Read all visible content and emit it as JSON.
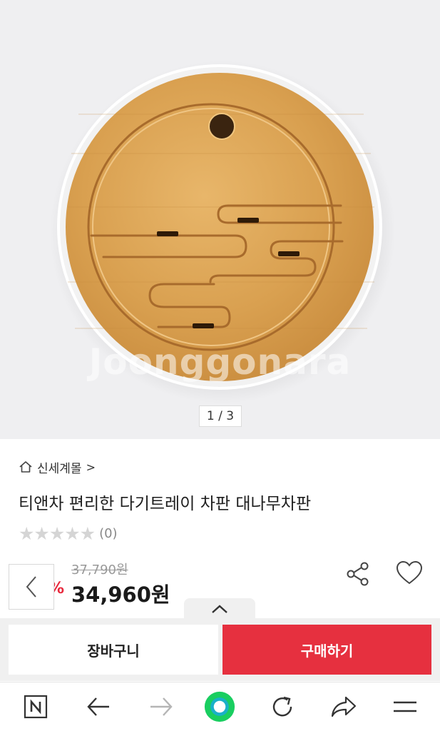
{
  "gallery": {
    "watermark": "Joonggonara",
    "page_indicator": "1 / 3"
  },
  "product": {
    "store_name": "신세계몰",
    "store_chevron": ">",
    "title": "티앤차 편리한 다기트레이 차판 대나무차판",
    "stars": "★★★★★",
    "rating_out_of_5": 0,
    "review_count": "(0)",
    "original_price": "37,790원",
    "discount_fragment": "%",
    "price": "34,960원"
  },
  "actions": {
    "cart_label": "장바구니",
    "buy_label": "구매하기"
  },
  "icons": {
    "home": "home-icon",
    "prev": "chevron-left-icon",
    "share": "share-icon",
    "heart": "heart-icon",
    "expand": "chevron-up-icon",
    "naver": "naver-n-icon",
    "back": "arrow-left-icon",
    "forward": "arrow-right-icon",
    "green_dot": "green-circle-icon",
    "reload": "reload-icon",
    "share_arrow": "share-arrow-icon",
    "menu": "hamburger-menu-icon"
  },
  "colors": {
    "accent_red": "#e6303f",
    "price_red": "#e8283c",
    "naver_green": "#19ce60"
  }
}
